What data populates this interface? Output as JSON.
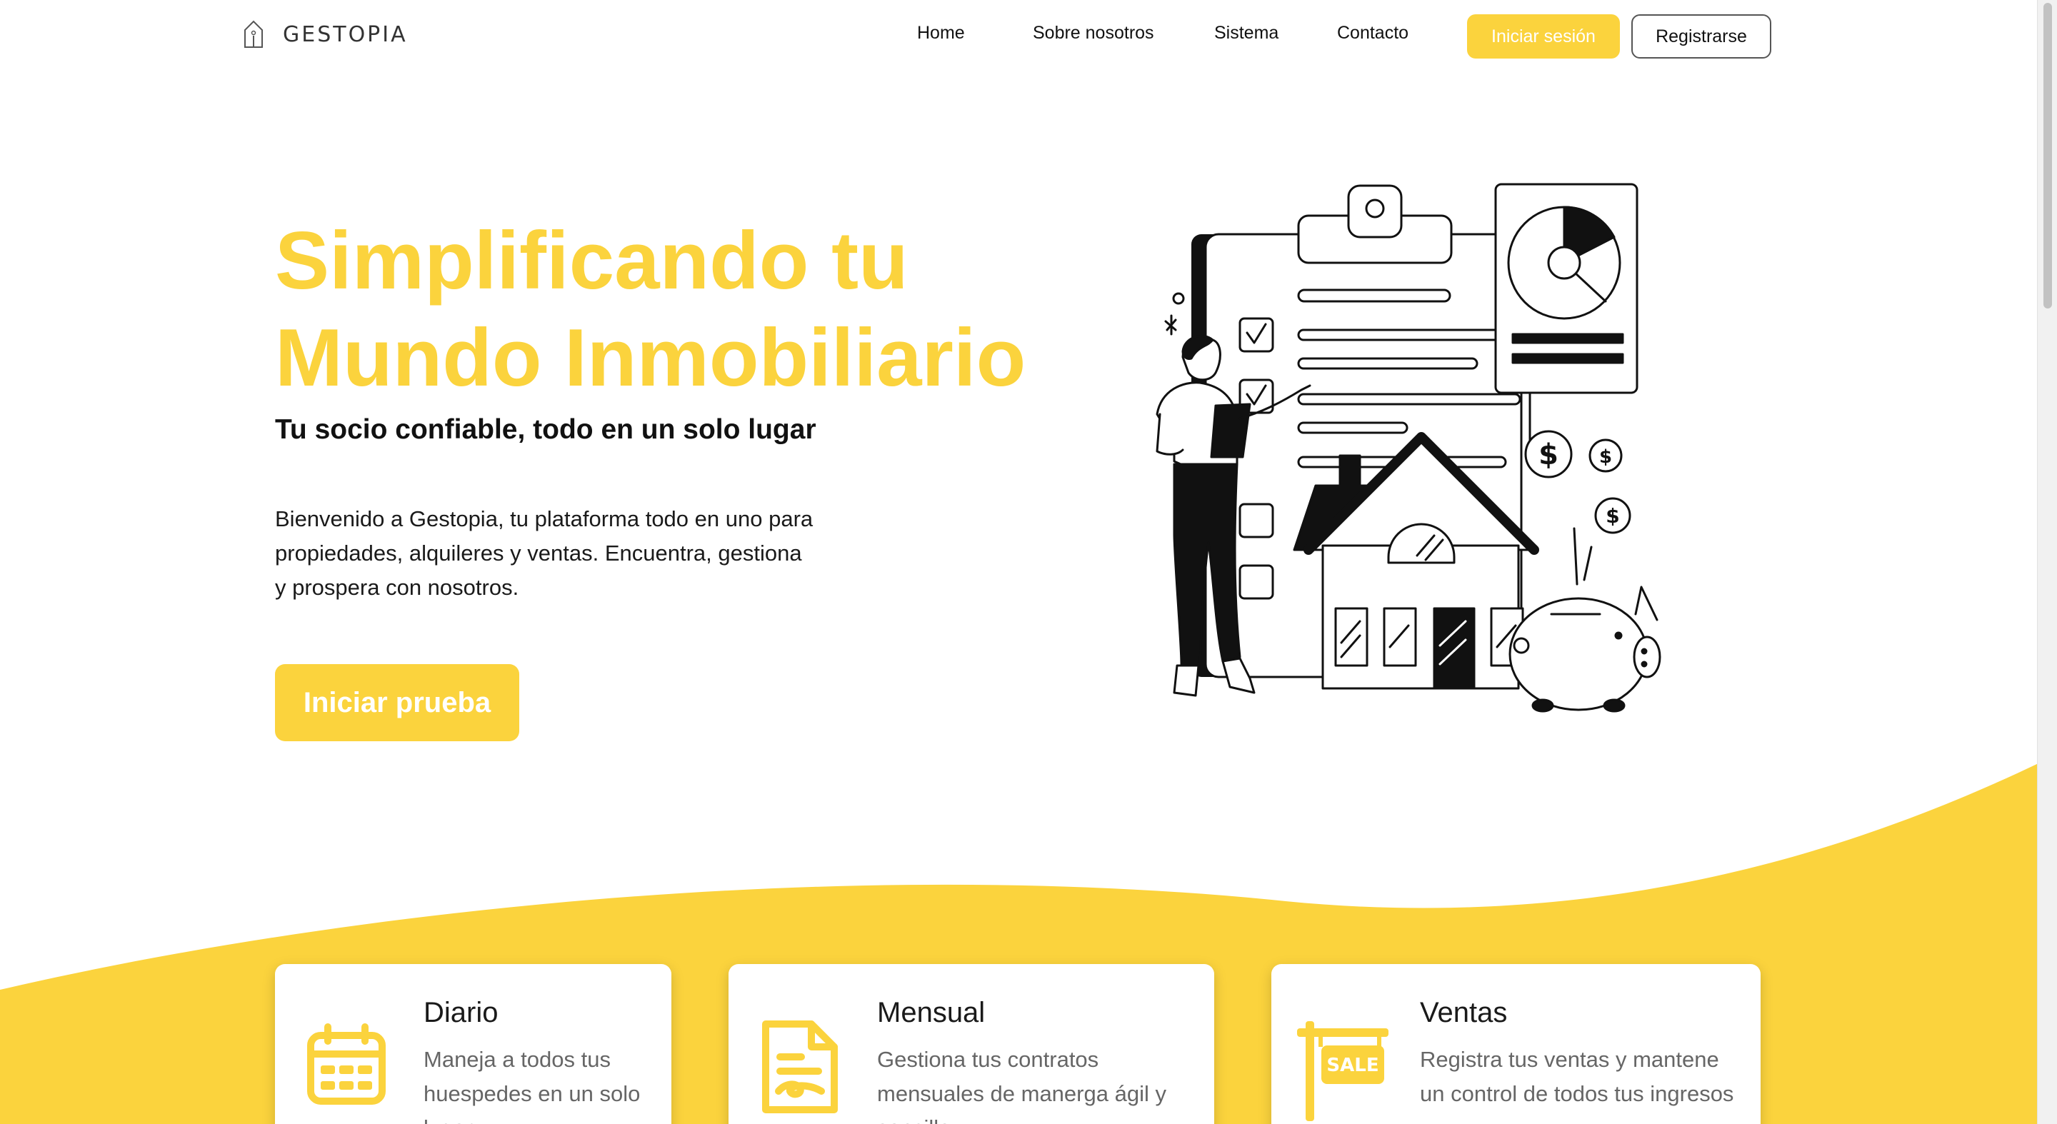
{
  "brand": {
    "name": "GESTOPIA",
    "logo_icon": "house-outline-icon",
    "accent_color": "#fbd33d"
  },
  "nav": {
    "links": [
      "Home",
      "Sobre nosotros",
      "Sistema",
      "Contacto"
    ],
    "login_label": "Iniciar sesión",
    "register_label": "Registrarse"
  },
  "hero": {
    "title_line1": "Simplificando tu",
    "title_line2": "Mundo Inmobiliario",
    "subtitle": "Tu socio confiable, todo en un solo lugar",
    "description": "Bienvenido a Gestopia, tu plataforma todo en uno para propiedades, alquileres y ventas. Encuentra, gestiona y prospera con nosotros.",
    "cta_label": "Iniciar prueba",
    "illustration": "real-estate-illustration"
  },
  "features": [
    {
      "title": "Diario",
      "description": "Maneja a todos tus huespedes en un solo lugar",
      "icon": "calendar-icon"
    },
    {
      "title": "Mensual",
      "description": "Gestiona tus contratos mensuales de manerga ágil y sencilla",
      "icon": "contract-document-icon"
    },
    {
      "title": "Ventas",
      "description": "Registra tus ventas y mantene un control de todos tus ingresos",
      "icon": "sale-sign-icon"
    }
  ]
}
